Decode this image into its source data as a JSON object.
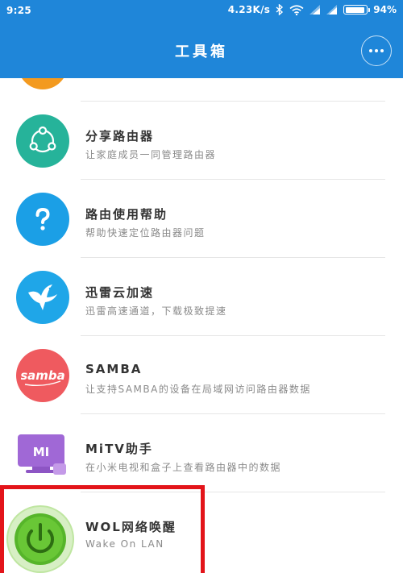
{
  "status_bar": {
    "time": "9:25",
    "speed": "4.23K/s",
    "battery_percent": "94%",
    "battery_level": 0.94,
    "icons": [
      "bluetooth-icon",
      "wifi-icon",
      "signal-icon",
      "signal-icon",
      "battery-icon"
    ]
  },
  "header": {
    "title": "工具箱",
    "more_icon": "more-icon"
  },
  "colors": {
    "accent": "#1f86d9",
    "highlight_border": "#e3141a"
  },
  "items": [
    {
      "title": "分享路由器",
      "subtitle": "让家庭成员一同管理路由器",
      "icon": "share-icon"
    },
    {
      "title": "路由使用帮助",
      "subtitle": "帮助快速定位路由器问题",
      "icon": "help-icon"
    },
    {
      "title": "迅雷云加速",
      "subtitle": "迅雷高速通道，下载极致提速",
      "icon": "xunlei-bird-icon"
    },
    {
      "title": "SAMBA",
      "subtitle": "让支持SAMBA的设备在局域网访问路由器数据",
      "icon": "samba-icon"
    },
    {
      "title": "MiTV助手",
      "subtitle": "在小米电视和盒子上查看路由器中的数据",
      "icon": "mitv-icon"
    },
    {
      "title": "WOL网络唤醒",
      "subtitle": "Wake On LAN",
      "icon": "power-icon"
    }
  ]
}
